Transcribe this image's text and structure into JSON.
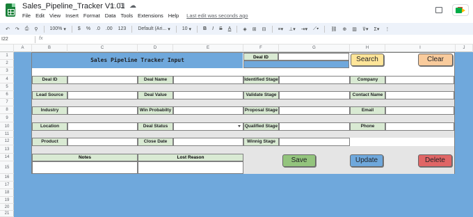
{
  "doc": {
    "title": "Sales_Pipeline_Tracker V1.01",
    "last_edit": "Last edit was seconds ago",
    "menu": [
      "File",
      "Edit",
      "View",
      "Insert",
      "Format",
      "Data",
      "Tools",
      "Extensions",
      "Help"
    ]
  },
  "toolbar": {
    "zoom": "100%",
    "currency": "$",
    "percent": "%",
    "decimal_decrease": ".0",
    "decimal_increase": ".00",
    "more_formats": "123",
    "font": "Default (Ari...",
    "font_size": "10",
    "bold": "B",
    "italic": "I",
    "strike": "S",
    "text_color": "A"
  },
  "formula_bar": {
    "cell_ref": "I22",
    "fx": "fx",
    "content": ""
  },
  "columns": [
    "A",
    "B",
    "C",
    "D",
    "E",
    "F",
    "G",
    "H",
    "I",
    "J"
  ],
  "rows": [
    "1",
    "2",
    "3",
    "4",
    "5",
    "6",
    "7",
    "8",
    "9",
    "10",
    "11",
    "12",
    "13",
    "14",
    "15",
    "16",
    "17",
    "18",
    "19",
    "20",
    "21"
  ],
  "form": {
    "title": "Sales Pipeline Tracker Input",
    "top_deal_id_label": "Deal ID",
    "fields": {
      "deal_id": "Deal ID",
      "deal_name": "Deal Name",
      "identified_stage": "Identified Stage",
      "company": "Company",
      "lead_source": "Lead Source",
      "deal_value": "Deal Value",
      "validate_stage": "Validate Stage",
      "contact_name": "Contact Name",
      "industry": "Industry",
      "win_probability": "Win Probabilty",
      "proposal_stage": "Proposal Stage",
      "email": "Email",
      "location": "Location",
      "deal_status": "Deal Status",
      "qualified_stage": "Qualified Stage",
      "phone": "Phone",
      "product": "Product",
      "close_date": "Close Date",
      "winning_stage": "Winnig Stage"
    },
    "notes_label": "Notes",
    "lost_reason_label": "Lost Reason"
  },
  "buttons": {
    "search": "Search",
    "clear": "Clear",
    "save": "Save",
    "update": "Update",
    "delete": "Delete"
  },
  "colors": {
    "sheet_blue": "#6fa8dc",
    "label_green": "#d9ead3",
    "search_btn": "#ffe599",
    "clear_btn": "#f9cb9c",
    "save_btn": "#93c47d",
    "update_btn": "#6fa8dc",
    "delete_btn": "#e06666"
  }
}
